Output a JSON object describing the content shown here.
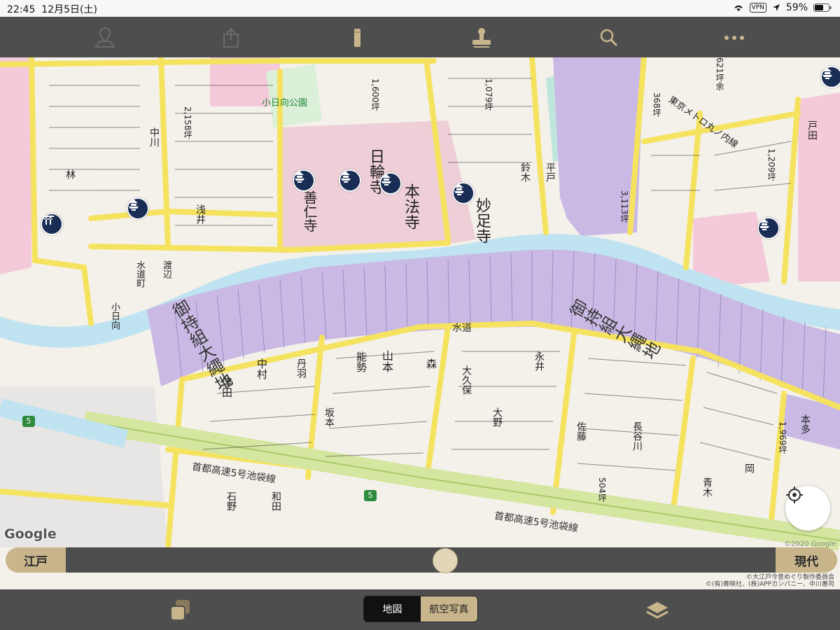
{
  "status_bar": {
    "time": "22:45",
    "date": "12月5日(土)",
    "vpn": "VPN",
    "battery": "59%"
  },
  "toolbar": {
    "icons": [
      "map-pin-icon",
      "share-icon",
      "pencil-icon",
      "stamp-icon",
      "search-icon",
      "more-icon"
    ]
  },
  "map": {
    "park_label": "小日向公園",
    "metro_label": "東京メトロ丸ノ内線",
    "water_label": "水道",
    "highway_label_1": "首都高速5号池袋線",
    "highway_label_2": "首都高速5号池袋線",
    "district_big_1": "御持組大繩地",
    "district_big_2": "御持組大繩地",
    "temple_labels": [
      "本法寺",
      "妙足寺",
      "日輪寺",
      "善仁寺"
    ],
    "area_label_1": "小日向",
    "area_label_2": "水道町",
    "area_label_3": "渡辺",
    "shield_labels": [
      "5",
      "5"
    ],
    "parcel_labels": [
      "2,158坪",
      "1,600坪",
      "1,079坪",
      "368坪",
      "1,209坪",
      "1,969坪",
      "504坪",
      "3,113坪",
      "621坪余"
    ],
    "owner_labels": [
      "山本",
      "能勢",
      "津田",
      "中村",
      "森",
      "浅井",
      "林",
      "岡",
      "大久保",
      "丹羽",
      "中川",
      "鈴木",
      "永井",
      "平戸",
      "大野",
      "坂本",
      "長谷川",
      "本多",
      "戸田",
      "佐藤",
      "石野",
      "和田",
      "青木"
    ]
  },
  "slider": {
    "left_label": "江戸",
    "right_label": "現代",
    "position": 0.5
  },
  "map_credit": {
    "google": "Google",
    "copyright": "©2020 Google",
    "line1": "©大江戸今昔めぐり製作委員会",
    "line2": "©(有)菁映社、(株)APPカンパニー、中川惠司"
  },
  "bottom_bar": {
    "map_tab": "地図",
    "aerial_tab": "航空写真",
    "active_tab": "航空写真",
    "icons": [
      "copy-icon",
      "layers-icon"
    ]
  },
  "colors": {
    "toolbar": "#4e4e4e",
    "accent": "#c9b58c",
    "samurai_land": "#c9b9e4",
    "temple_land": "#f4c9d9",
    "road": "#f5e25e",
    "river": "#bfe3f0"
  }
}
